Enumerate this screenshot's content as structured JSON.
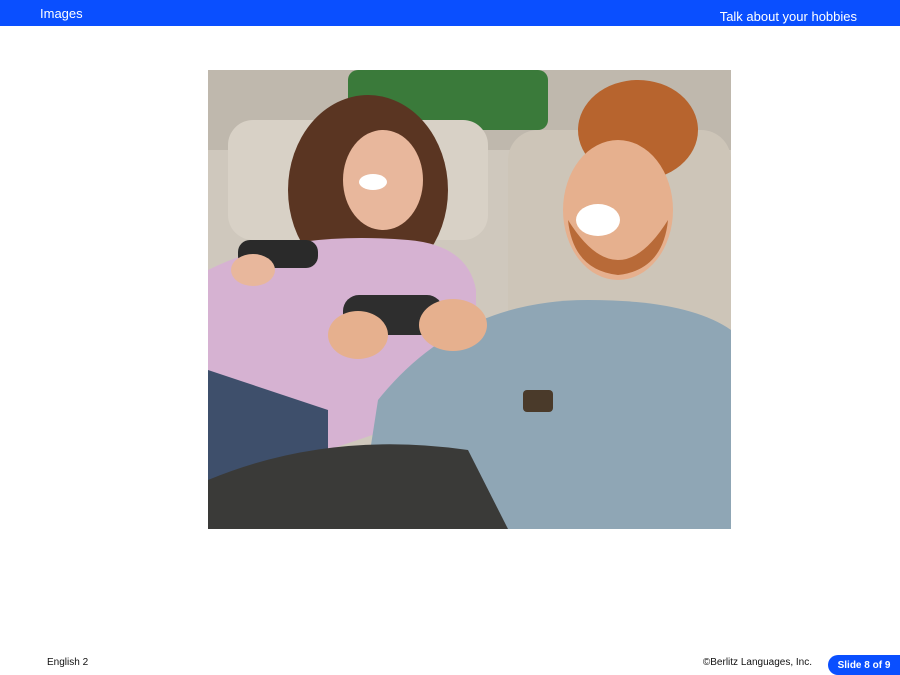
{
  "header": {
    "section_label": "Images",
    "lesson_title": "Talk about your hobbies"
  },
  "image": {
    "subject": "couple-playing-video-games"
  },
  "footer": {
    "course": "English 2",
    "copyright": "©Berlitz Languages, Inc.",
    "slide_indicator": "Slide 8 of 9"
  },
  "colors": {
    "brand_blue": "#0a4fff",
    "background": "#ffffff"
  }
}
